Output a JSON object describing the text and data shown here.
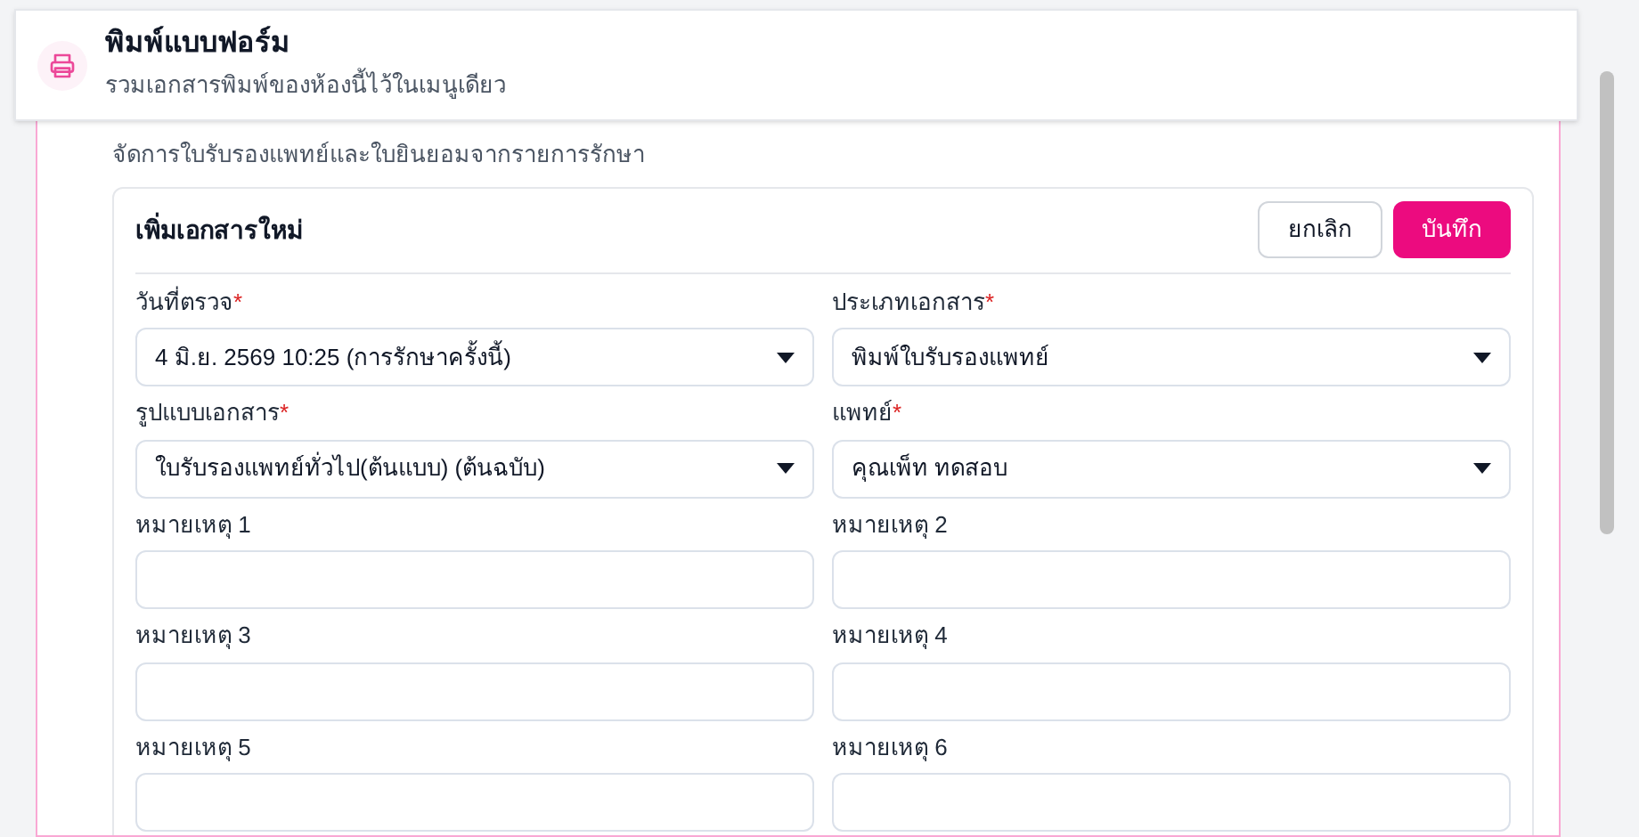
{
  "header": {
    "title": "พิมพ์แบบฟอร์ม",
    "subtitle": "รวมเอกสารพิมพ์ของห้องนี้ไว้ในเมนูเดียว"
  },
  "panel": {
    "description": "จัดการใบรับรองแพทย์และใบยินยอมจากรายการรักษา"
  },
  "form": {
    "title": "เพิ่มเอกสารใหม่",
    "buttons": [
      {
        "label": "ยกเลิก",
        "kind": "secondary"
      },
      {
        "label": "บันทึก",
        "kind": "primary"
      }
    ],
    "fields": [
      {
        "label": "วันที่ตรวจ",
        "required_mark": "*",
        "kind": "select",
        "value": "4 มิ.ย. 2569 10:25 (การรักษาครั้งนี้)"
      },
      {
        "label": "ประเภทเอกสาร",
        "required_mark": "*",
        "kind": "select",
        "value": "พิมพ์ใบรับรองแพทย์"
      },
      {
        "label": "รูปแบบเอกสาร",
        "required_mark": "*",
        "kind": "select",
        "value": "ใบรับรองแพทย์ทั่วไป(ต้นแบบ) (ต้นฉบับ)"
      },
      {
        "label": "แพทย์",
        "required_mark": "*",
        "kind": "select",
        "value": "คุณเพ็ท ทดสอบ"
      },
      {
        "label": "หมายเหตุ 1",
        "kind": "text"
      },
      {
        "label": "หมายเหตุ 2",
        "kind": "text"
      },
      {
        "label": "หมายเหตุ 3",
        "kind": "text"
      },
      {
        "label": "หมายเหตุ 4",
        "kind": "text"
      },
      {
        "label": "หมายเหตุ 5",
        "kind": "text"
      },
      {
        "label": "หมายเหตุ 6",
        "kind": "text"
      }
    ]
  }
}
